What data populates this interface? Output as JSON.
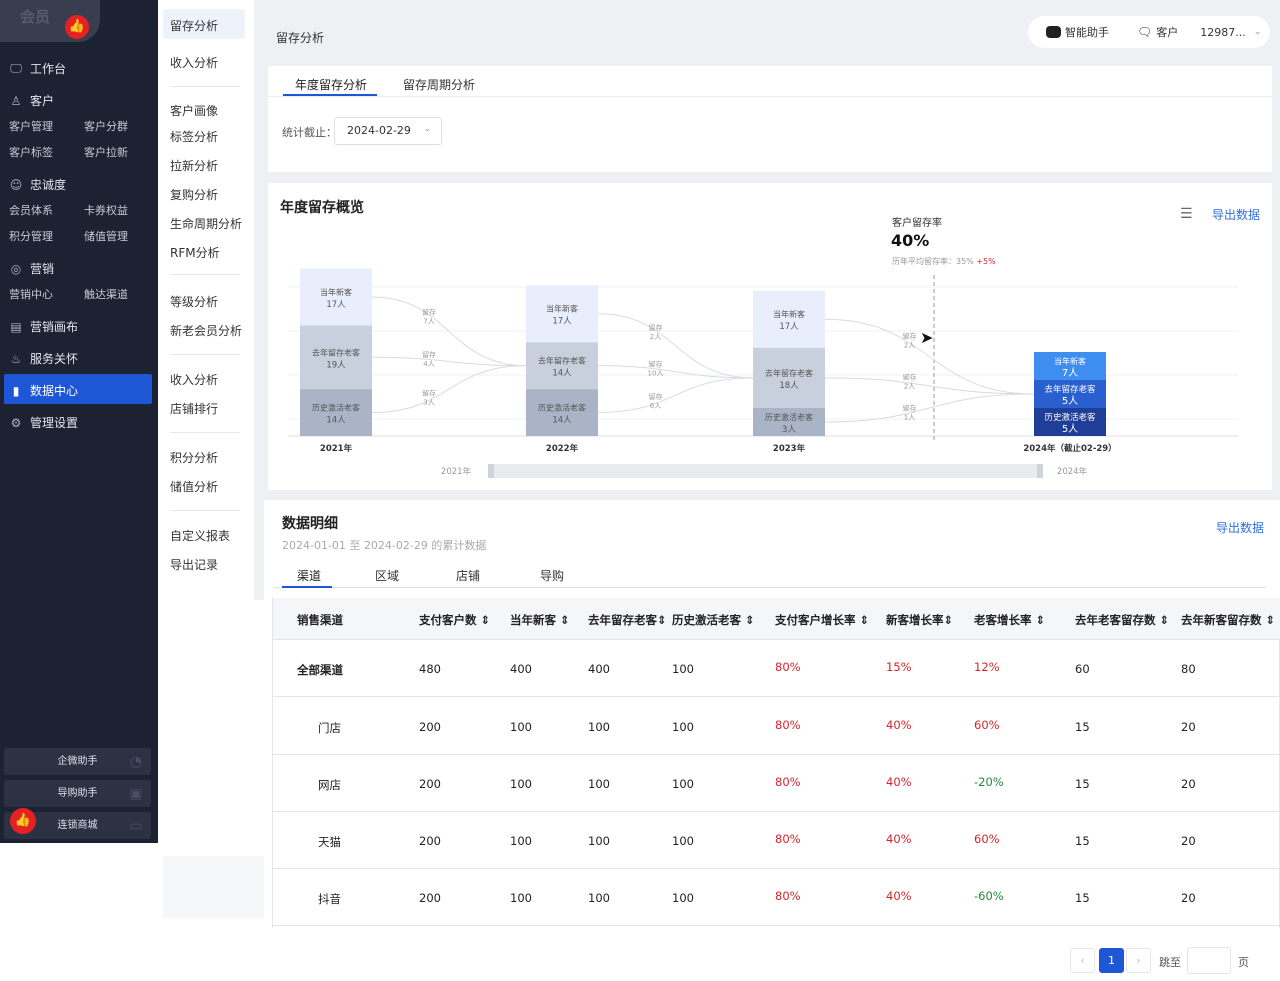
{
  "sidebar": {
    "logo_text": "会员",
    "items": [
      {
        "label": "工作台"
      },
      {
        "label": "客户"
      },
      {
        "label": "忠诚度"
      },
      {
        "label": "营销"
      },
      {
        "label": "营销画布"
      },
      {
        "label": "服务关怀"
      },
      {
        "label": "数据中心"
      },
      {
        "label": "管理设置"
      }
    ],
    "subs": [
      "客户管理",
      "客户分群",
      "客户标签",
      "客户拉新",
      "会员体系",
      "卡券权益",
      "积分管理",
      "储值管理",
      "营销中心",
      "触达渠道"
    ],
    "bottom": [
      "企微助手",
      "导购助手",
      "连锁商城"
    ]
  },
  "submenu": [
    "留存分析",
    "收入分析",
    "客户画像",
    "标签分析",
    "拉新分析",
    "复购分析",
    "生命周期分析",
    "RFM分析",
    "等级分析",
    "新老会员分析",
    "收入分析",
    "店铺排行",
    "积分分析",
    "储值分析",
    "自定义报表",
    "导出记录"
  ],
  "header": {
    "title": "留存分析"
  },
  "topbar": {
    "assistant": "智能助手",
    "customer": "客户",
    "account": "12987..."
  },
  "tabs": [
    "年度留存分析",
    "留存周期分析"
  ],
  "filter": {
    "label": "统计截止：",
    "date": "2024-02-29"
  },
  "overview": {
    "title": "年度留存概览",
    "export": "导出数据"
  },
  "tooltip": {
    "label": "客户留存率",
    "value": "40%",
    "avg_label": "历年平均留存率：",
    "avg_value": "35%",
    "delta": "+5%"
  },
  "chart_data": {
    "type": "bar",
    "categories": [
      "2021年",
      "2022年",
      "2023年",
      "2024年（截止02-29）"
    ],
    "series": [
      {
        "name": "当年新客",
        "values": [
          17,
          17,
          17,
          7
        ]
      },
      {
        "name": "去年留存老客",
        "values": [
          19,
          14,
          18,
          5
        ]
      },
      {
        "name": "历史激活老客",
        "values": [
          14,
          14,
          3,
          5
        ]
      }
    ],
    "flows": [
      {
        "label": "留存",
        "value": "7人"
      },
      {
        "label": "留存",
        "value": "4人"
      },
      {
        "label": "留存",
        "value": "3人"
      },
      {
        "label": "留存",
        "value": "2人"
      },
      {
        "label": "留存",
        "value": "10人"
      },
      {
        "label": "留存",
        "value": "6人"
      },
      {
        "label": "留存",
        "value": "2人"
      },
      {
        "label": "留存",
        "value": "2人"
      },
      {
        "label": "留存",
        "value": "1人"
      }
    ],
    "range": {
      "start": "2021年",
      "end": "2024年"
    }
  },
  "detail": {
    "title": "数据明细",
    "subtitle": "2024-01-01 至 2024-02-29 的累计数据",
    "export": "导出数据",
    "tabs": [
      "渠道",
      "区域",
      "店铺",
      "导购"
    ]
  },
  "table": {
    "headers": [
      "销售渠道",
      "支付客户数",
      "当年新客",
      "去年留存老客",
      "历史激活老客",
      "支付客户增长率",
      "新客增长率",
      "老客增长率",
      "去年老客留存数",
      "去年新客留存数"
    ],
    "rows": [
      [
        "全部渠道",
        "480",
        "400",
        "400",
        "100",
        "80%",
        "15%",
        "12%",
        "60",
        "80"
      ],
      [
        "门店",
        "200",
        "100",
        "100",
        "100",
        "80%",
        "40%",
        "60%",
        "15",
        "20"
      ],
      [
        "网店",
        "200",
        "100",
        "100",
        "100",
        "80%",
        "40%",
        "-20%",
        "15",
        "20"
      ],
      [
        "天猫",
        "200",
        "100",
        "100",
        "100",
        "80%",
        "40%",
        "60%",
        "15",
        "20"
      ],
      [
        "抖音",
        "200",
        "100",
        "100",
        "100",
        "80%",
        "40%",
        "-60%",
        "15",
        "20"
      ]
    ]
  },
  "pagination": {
    "current": "1",
    "jump_label": "跳至",
    "page_suffix": "页"
  }
}
